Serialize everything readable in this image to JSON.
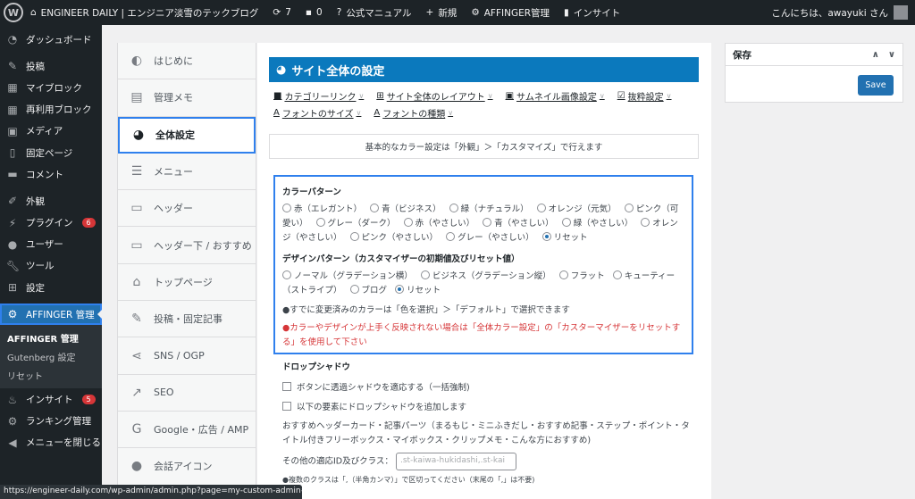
{
  "admin_bar": {
    "site_title": "ENGINEER DAILY | エンジニア淡雪のテックブログ",
    "updates_count": "7",
    "comments_count": "0",
    "manual": "公式マニュアル",
    "new": "新規",
    "affinger_admin": "AFFINGER管理",
    "insight": "インサイト",
    "greeting": "こんにちは、awayuki さん"
  },
  "sidebar": {
    "items": [
      {
        "label": "ダッシュボード",
        "icon": "dashboard-icon"
      },
      {
        "label": "投稿",
        "icon": "pin-icon"
      },
      {
        "label": "マイブロック",
        "icon": "grid-icon"
      },
      {
        "label": "再利用ブロック",
        "icon": "grid-icon"
      },
      {
        "label": "メディア",
        "icon": "media-icon"
      },
      {
        "label": "固定ページ",
        "icon": "page-icon"
      },
      {
        "label": "コメント",
        "icon": "comment-icon"
      },
      {
        "label": "外観",
        "icon": "brush-icon"
      },
      {
        "label": "プラグイン",
        "icon": "plugin-icon",
        "badge": "6"
      },
      {
        "label": "ユーザー",
        "icon": "user-icon"
      },
      {
        "label": "ツール",
        "icon": "wrench-icon"
      },
      {
        "label": "設定",
        "icon": "settings-icon"
      },
      {
        "label": "AFFINGER 管理",
        "icon": "gear-icon"
      }
    ],
    "submenu": [
      "AFFINGER 管理",
      "Gutenberg 設定",
      "リセット"
    ],
    "lower": [
      {
        "label": "インサイト",
        "icon": "insight-icon",
        "badge": "5"
      },
      {
        "label": "ランキング管理",
        "icon": "gear-icon"
      },
      {
        "label": "メニューを閉じる",
        "icon": "collapse-icon"
      }
    ]
  },
  "settings_nav": [
    {
      "label": "はじめに",
      "icon": "shield-icon"
    },
    {
      "label": "管理メモ",
      "icon": "memo-icon"
    },
    {
      "label": "全体設定",
      "icon": "palette-icon"
    },
    {
      "label": "メニュー",
      "icon": "menu-icon"
    },
    {
      "label": "ヘッダー",
      "icon": "header-icon"
    },
    {
      "label": "ヘッダー下 / おすすめ",
      "icon": "header-below-icon"
    },
    {
      "label": "トップページ",
      "icon": "home-icon"
    },
    {
      "label": "投稿・固定記事",
      "icon": "edit-icon"
    },
    {
      "label": "SNS / OGP",
      "icon": "share-icon"
    },
    {
      "label": "SEO",
      "icon": "chart-icon"
    },
    {
      "label": "Google・広告 / AMP",
      "icon": "google-icon"
    },
    {
      "label": "会話アイコン",
      "icon": "chat-icon"
    }
  ],
  "main": {
    "title": "サイト全体の設定",
    "links": [
      {
        "label": "カテゴリーリンク",
        "icon": "folder-icon"
      },
      {
        "label": "サイト全体のレイアウト",
        "icon": "layout-icon"
      },
      {
        "label": "サムネイル画像設定",
        "icon": "image-icon"
      },
      {
        "label": "抜粋設定",
        "icon": "excerpt-icon"
      },
      {
        "label": "フォントのサイズ",
        "icon": "font-icon"
      },
      {
        "label": "フォントの種類",
        "icon": "font-icon"
      }
    ],
    "info": "基本的なカラー設定は「外観」＞「カスタマイズ」で行えます",
    "color_pattern": {
      "heading": "カラーパターン",
      "options": [
        "赤（エレガント）",
        "青（ビジネス）",
        "緑（ナチュラル）",
        "オレンジ（元気）",
        "ピンク（可愛い）",
        "グレー（ダーク）",
        "赤（やさしい）",
        "青（やさしい）",
        "緑（やさしい）",
        "オレンジ（やさしい）",
        "ピンク（やさしい）",
        "グレー（やさしい）",
        "リセット"
      ],
      "selected": 12
    },
    "design_pattern": {
      "heading": "デザインパターン（カスタマイザーの初期値及びリセット値）",
      "options": [
        "ノーマル（グラデーション横）",
        "ビジネス（グラデーション縦）",
        "フラット",
        "キューティー（ストライプ）",
        "ブログ",
        "リセット"
      ],
      "selected": 5
    },
    "note1": "●すでに変更済みのカラーは「色を選択」＞「デフォルト」で選択できます",
    "note2": "●カラーやデザインが上手く反映されない場合は「全体カラー設定」の「カスターマイザーをリセットする」を使用して下さい",
    "dropshadow": {
      "heading": "ドロップシャドウ",
      "opt1": "ボタンに透過シャドウを適応する（一括強制)",
      "opt2": "以下の要素にドロップシャドウを追加します",
      "desc": "おすすめヘッダーカード・記事パーツ（まるもじ・ミニふきだし・おすすめ記事・ステップ・ポイント・タイトル付きフリーボックス・マイボックス・クリップメモ・こんな方におすすめ)",
      "field_label": "その他の適応ID及びクラス：",
      "field_placeholder": ".st-kaiwa-hukidashi,.st-kai",
      "field_note": "●複数のクラスは「,（半角カンマ）」で区切ってください（末尾の「,」は不要)"
    }
  },
  "save_box": {
    "title": "保存",
    "button": "Save"
  },
  "status_url": "https://engineer-daily.com/wp-admin/admin.php?page=my-custom-admin#layou..."
}
